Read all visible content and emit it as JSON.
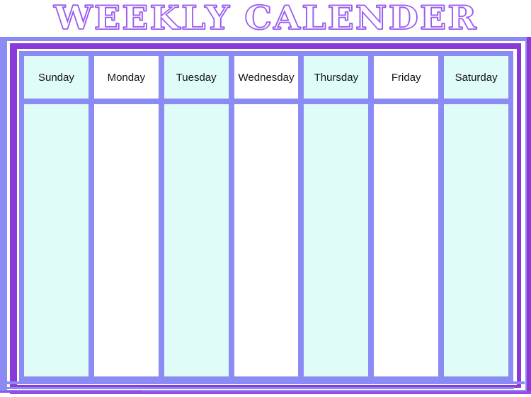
{
  "header": {
    "title": "WEEKLY CALENDER"
  },
  "theme": {
    "title_outline": "#9a5cf0",
    "frame_periwinkle": "#8b8bf5",
    "frame_purple": "#8a3ad8",
    "cell_tint": "#e0fcf8",
    "cell_plain": "#ffffff",
    "text": "#131313"
  },
  "calendar": {
    "columns": [
      {
        "label": "Sunday",
        "tint": "cyan"
      },
      {
        "label": "Monday",
        "tint": "white"
      },
      {
        "label": "Tuesday",
        "tint": "cyan"
      },
      {
        "label": "Wednesday",
        "tint": "white"
      },
      {
        "label": "Thursday",
        "tint": "cyan"
      },
      {
        "label": "Friday",
        "tint": "white"
      },
      {
        "label": "Saturday",
        "tint": "cyan"
      }
    ],
    "body_entries": [
      "",
      "",
      "",
      "",
      "",
      "",
      ""
    ]
  }
}
